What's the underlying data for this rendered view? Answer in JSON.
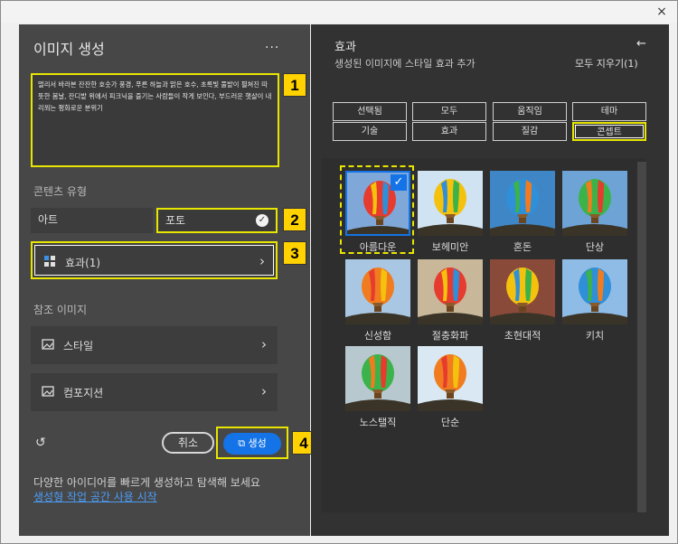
{
  "window": {
    "close_icon": "×"
  },
  "left": {
    "title": "이미지 생성",
    "more": "...",
    "prompt": "멀리서 바라본 잔잔한 호숫가 풍경, 푸른 하늘과 맑은 호수, 초록빛 풀밭이 펼쳐진 따뜻한 봄날, 잔디밭 위에서 피크닉을 즐기는 사람들이 작게 보인다, 부드러운 햇살이 내리쬐는 평화로운 분위기",
    "content_type_label": "콘텐츠 유형",
    "type_art": "아트",
    "type_photo": "포토",
    "effects_label": "효과(1)",
    "reference_label": "참조 이미지",
    "style_label": "스타일",
    "composition_label": "컴포지션",
    "cancel": "취소",
    "generate": "생성",
    "tip": "다양한 아이디어를 빠르게 생성하고 탐색해 보세요",
    "link": "생성형 작업 공간 사용 시작"
  },
  "badges": [
    "1",
    "2",
    "3",
    "4"
  ],
  "right": {
    "title": "효과",
    "subtitle": "생성된 이미지에 스타일 효과 추가",
    "back_icon": "←",
    "clear_all": "모두 지우기(1)",
    "filters_row1": [
      "선택됨",
      "모두",
      "움직임",
      "테마"
    ],
    "filters_row2": [
      "기술",
      "효과",
      "질감",
      "콘셉트"
    ],
    "tiles": [
      {
        "label": "아름다운",
        "bg": "#7fa8d9",
        "selected": true
      },
      {
        "label": "보헤미안",
        "bg": "#cfe3f2",
        "selected": false
      },
      {
        "label": "혼돈",
        "bg": "#3f86c7",
        "selected": false
      },
      {
        "label": "단상",
        "bg": "#6ea3d6",
        "selected": false
      },
      {
        "label": "신성함",
        "bg": "#a9c7e3",
        "selected": false
      },
      {
        "label": "절충화파",
        "bg": "#c9b79a",
        "selected": false
      },
      {
        "label": "초현대적",
        "bg": "#8a4a3a",
        "selected": false
      },
      {
        "label": "키치",
        "bg": "#8fbce6",
        "selected": false
      },
      {
        "label": "노스탤직",
        "bg": "#b7c9cf",
        "selected": false
      },
      {
        "label": "단순",
        "bg": "#d9e8f3",
        "selected": false
      }
    ]
  }
}
